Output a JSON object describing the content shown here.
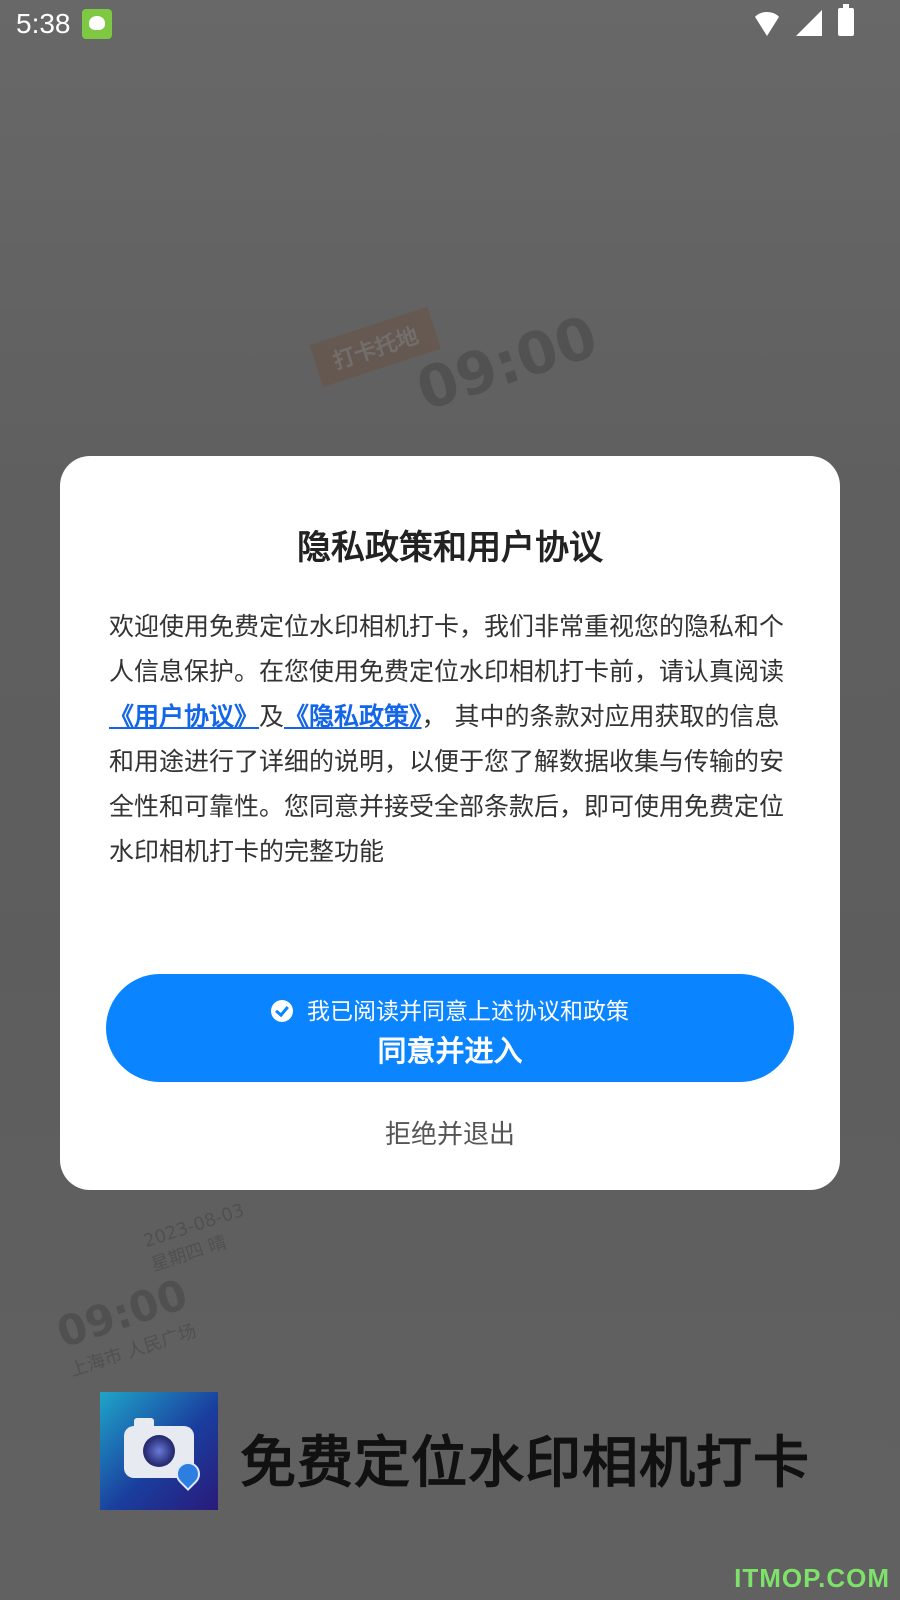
{
  "status_bar": {
    "time": "5:38"
  },
  "dialog": {
    "title": "隐私政策和用户协议",
    "body_part1": "欢迎使用免费定位水印相机打卡，我们非常重视您的隐私和个人信息保护。在您使用免费定位水印相机打卡前，请认真阅读",
    "user_agreement_link": "《用户协议》",
    "connector": "及",
    "privacy_policy_link": "《隐私政策》",
    "body_part2": "， 其中的条款对应用获取的信息和用途进行了详细的说明，以便于您了解数据收集与传输的安全性和可靠性。您同意并接受全部条款后，即可使用免费定位水印相机打卡的完整功能",
    "consent_text": "我已阅读并同意上述协议和政策",
    "agree_label": "同意并进入",
    "reject_label": "拒绝并退出"
  },
  "background": {
    "stamp1_time": "09:00",
    "stamp1_tag": "打卡托地",
    "stamp2_time": "09:00",
    "stamp2_date": "2023-08-03",
    "stamp2_week": "星期四 晴",
    "stamp2_place": "上海市 人民广场"
  },
  "brand": {
    "name": "免费定位水印相机打卡"
  },
  "watermark": "ITMOP.COM"
}
